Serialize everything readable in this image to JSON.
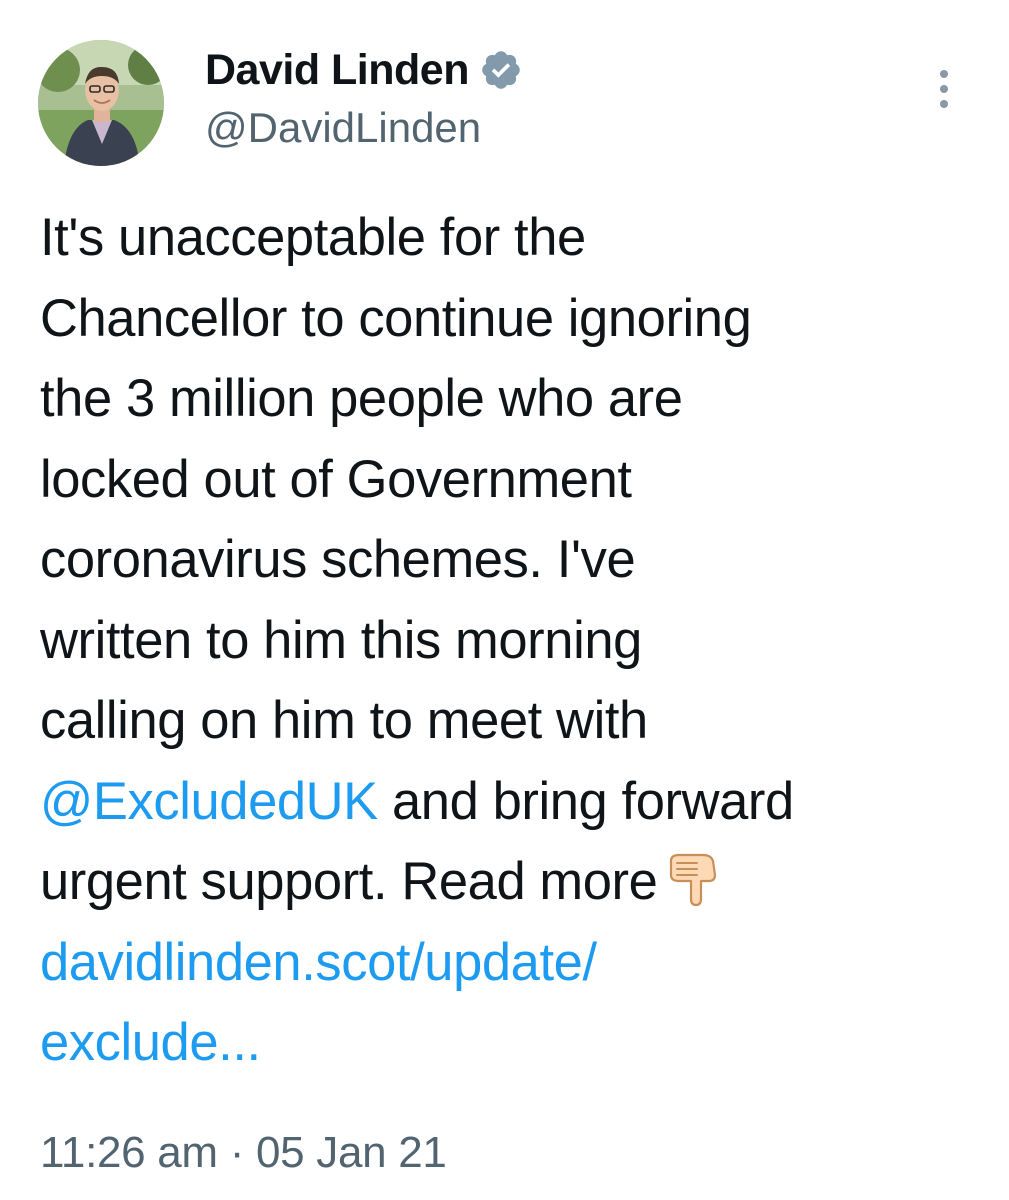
{
  "author": {
    "display_name": "David Linden",
    "handle": "@DavidLinden",
    "verified": true,
    "avatar_icon": "profile-photo"
  },
  "more_icon": "vertical-ellipsis-icon",
  "tweet": {
    "line1": "It's unacceptable for the",
    "line2": "Chancellor to continue ignoring",
    "line3": "the 3 million people who are",
    "line4": "locked out of Government",
    "line5": "coronavirus schemes. I've",
    "line6": "written to him this morning",
    "line7": "calling on him to meet with",
    "mention": "@ExcludedUK",
    "line8_rest": " and bring forward",
    "line9": "urgent support. Read more",
    "emoji": "backhand-index-pointing-down",
    "link_line1": "davidlinden.scot/update/",
    "link_line2": "exclude..."
  },
  "timestamp": "11:26 am · 05 Jan 21",
  "colors": {
    "text": "#0f1419",
    "secondary": "#536471",
    "link": "#1d9bf0",
    "verified_badge": "#829aab"
  }
}
